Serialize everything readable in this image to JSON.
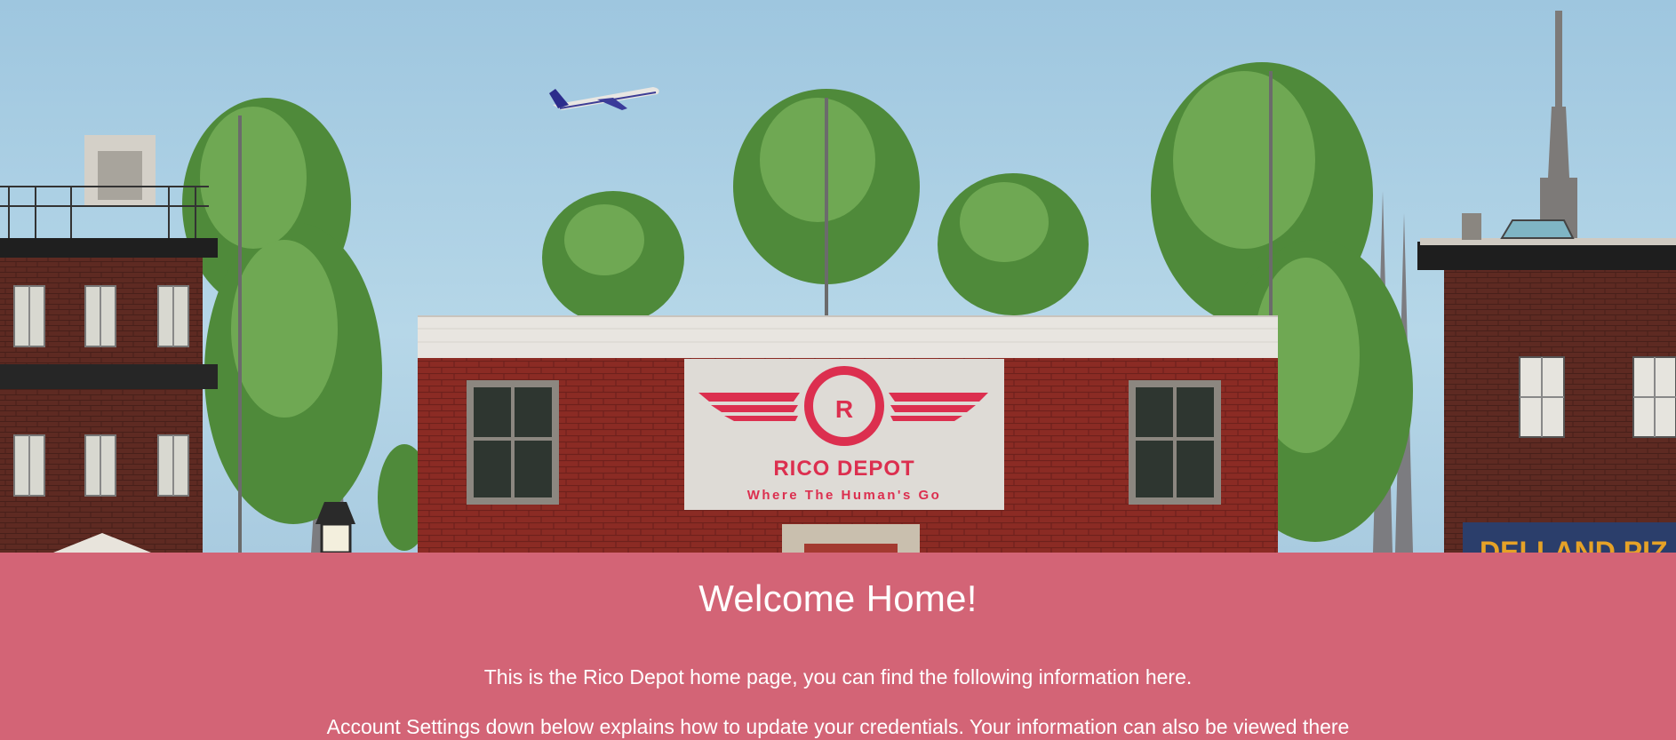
{
  "hero": {
    "sign_letter": "R",
    "sign_name": "RICO DEPOT",
    "sign_tagline": "Where The Human's Go",
    "shop_sign_fragment": "DELLAND PIZ"
  },
  "welcome": {
    "title": "Welcome Home!",
    "intro": "This is the Rico Depot home page, you can find the following information here.",
    "account_note": "Account Settings down below explains how to update your credentials. Your information can also be viewed there"
  },
  "colors": {
    "sky": "#a9cde2",
    "banner": "#d36476",
    "brick": "#8a2a22",
    "logo_red": "#dc2f4f",
    "text": "#ffffff"
  }
}
